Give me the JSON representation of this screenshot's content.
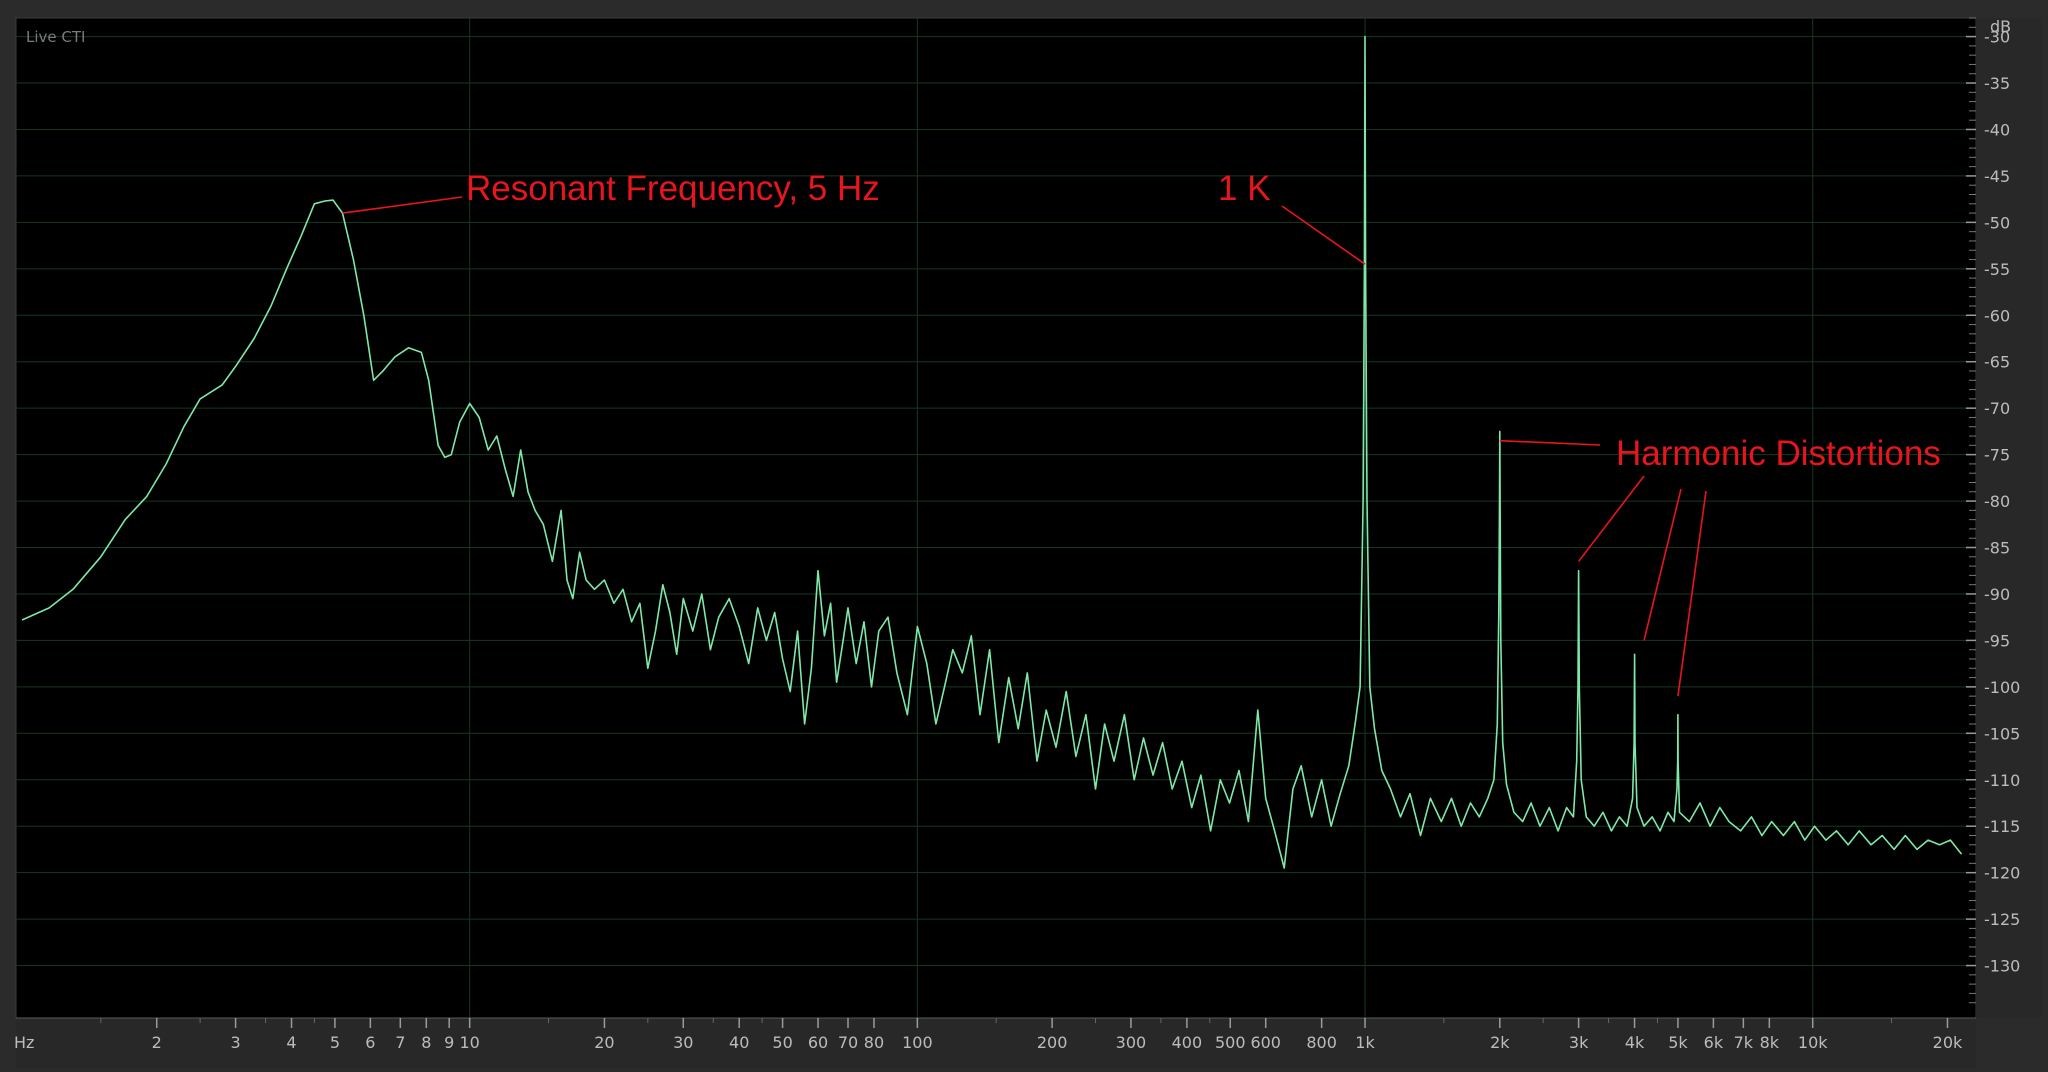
{
  "view": {
    "status_label": "Live CTI"
  },
  "chart_data": {
    "type": "line",
    "title": "",
    "xlabel": "Hz",
    "ylabel": "dB",
    "x_scale": "log",
    "xlim": [
      1,
      22000
    ],
    "ylim": [
      -135,
      -28
    ],
    "grid": true,
    "x_ticks": [
      {
        "value": 2,
        "label": "2"
      },
      {
        "value": 3,
        "label": "3"
      },
      {
        "value": 4,
        "label": "4"
      },
      {
        "value": 5,
        "label": "5"
      },
      {
        "value": 6,
        "label": "6"
      },
      {
        "value": 7,
        "label": "7"
      },
      {
        "value": 8,
        "label": "8"
      },
      {
        "value": 9,
        "label": "9"
      },
      {
        "value": 10,
        "label": "10"
      },
      {
        "value": 20,
        "label": "20"
      },
      {
        "value": 30,
        "label": "30"
      },
      {
        "value": 40,
        "label": "40"
      },
      {
        "value": 50,
        "label": "50"
      },
      {
        "value": 60,
        "label": "60"
      },
      {
        "value": 70,
        "label": "70"
      },
      {
        "value": 80,
        "label": "80"
      },
      {
        "value": 100,
        "label": "100"
      },
      {
        "value": 200,
        "label": "200"
      },
      {
        "value": 300,
        "label": "300"
      },
      {
        "value": 400,
        "label": "400"
      },
      {
        "value": 500,
        "label": "500"
      },
      {
        "value": 600,
        "label": "600"
      },
      {
        "value": 800,
        "label": "800"
      },
      {
        "value": 1000,
        "label": "1k"
      },
      {
        "value": 2000,
        "label": "2k"
      },
      {
        "value": 3000,
        "label": "3k"
      },
      {
        "value": 4000,
        "label": "4k"
      },
      {
        "value": 5000,
        "label": "5k"
      },
      {
        "value": 6000,
        "label": "6k"
      },
      {
        "value": 7000,
        "label": "7k"
      },
      {
        "value": 8000,
        "label": "8k"
      },
      {
        "value": 10000,
        "label": "10k"
      },
      {
        "value": 20000,
        "label": "20k"
      }
    ],
    "y_ticks": [
      {
        "value": -30,
        "label": "-30"
      },
      {
        "value": -35,
        "label": "-35"
      },
      {
        "value": -40,
        "label": "-40"
      },
      {
        "value": -45,
        "label": "-45"
      },
      {
        "value": -50,
        "label": "-50"
      },
      {
        "value": -55,
        "label": "-55"
      },
      {
        "value": -60,
        "label": "-60"
      },
      {
        "value": -65,
        "label": "-65"
      },
      {
        "value": -70,
        "label": "-70"
      },
      {
        "value": -75,
        "label": "-75"
      },
      {
        "value": -80,
        "label": "-80"
      },
      {
        "value": -85,
        "label": "-85"
      },
      {
        "value": -90,
        "label": "-90"
      },
      {
        "value": -95,
        "label": "-95"
      },
      {
        "value": -100,
        "label": "-100"
      },
      {
        "value": -105,
        "label": "-105"
      },
      {
        "value": -110,
        "label": "-110"
      },
      {
        "value": -115,
        "label": "-115"
      },
      {
        "value": -120,
        "label": "-120"
      },
      {
        "value": -125,
        "label": "-125"
      },
      {
        "value": -130,
        "label": "-130"
      }
    ],
    "series": [
      {
        "color": "#7ee8a8",
        "points": [
          [
            1.0,
            -92.8
          ],
          [
            1.15,
            -91.5
          ],
          [
            1.3,
            -89.5
          ],
          [
            1.5,
            -86
          ],
          [
            1.7,
            -82
          ],
          [
            1.9,
            -79.5
          ],
          [
            2.1,
            -76
          ],
          [
            2.3,
            -72
          ],
          [
            2.5,
            -69
          ],
          [
            2.8,
            -67.5
          ],
          [
            3.0,
            -65.5
          ],
          [
            3.3,
            -62.5
          ],
          [
            3.6,
            -59
          ],
          [
            3.9,
            -55
          ],
          [
            4.2,
            -51.5
          ],
          [
            4.5,
            -48
          ],
          [
            4.75,
            -47.7
          ],
          [
            4.95,
            -47.6
          ],
          [
            5.2,
            -49
          ],
          [
            5.5,
            -54
          ],
          [
            5.8,
            -60
          ],
          [
            6.1,
            -67
          ],
          [
            6.4,
            -66
          ],
          [
            6.8,
            -64.5
          ],
          [
            7.3,
            -63.5
          ],
          [
            7.8,
            -64
          ],
          [
            8.1,
            -67
          ],
          [
            8.5,
            -74
          ],
          [
            8.8,
            -75.3
          ],
          [
            9.1,
            -75
          ],
          [
            9.5,
            -71.5
          ],
          [
            10.0,
            -69.5
          ],
          [
            10.5,
            -71
          ],
          [
            11.0,
            -74.5
          ],
          [
            11.5,
            -73
          ],
          [
            12.0,
            -76.5
          ],
          [
            12.5,
            -79.5
          ],
          [
            13.0,
            -74.5
          ],
          [
            13.5,
            -79
          ],
          [
            14.0,
            -81
          ],
          [
            14.6,
            -82.5
          ],
          [
            15.3,
            -86.5
          ],
          [
            16.0,
            -81
          ],
          [
            16.5,
            -88.5
          ],
          [
            17.0,
            -90.5
          ],
          [
            17.6,
            -85.5
          ],
          [
            18.2,
            -88.5
          ],
          [
            19.0,
            -89.5
          ],
          [
            20.0,
            -88.5
          ],
          [
            21.0,
            -91
          ],
          [
            22.0,
            -89.5
          ],
          [
            23.0,
            -93
          ],
          [
            24.0,
            -91
          ],
          [
            25.0,
            -98
          ],
          [
            26.0,
            -94
          ],
          [
            27.0,
            -89
          ],
          [
            28.0,
            -92
          ],
          [
            29.0,
            -96.5
          ],
          [
            30.0,
            -90.5
          ],
          [
            31.5,
            -94
          ],
          [
            33.0,
            -90
          ],
          [
            34.5,
            -96
          ],
          [
            36.0,
            -92.5
          ],
          [
            38.0,
            -90.5
          ],
          [
            40.0,
            -93.5
          ],
          [
            42.0,
            -97.5
          ],
          [
            44.0,
            -91.5
          ],
          [
            46.0,
            -95
          ],
          [
            48.0,
            -92
          ],
          [
            50.0,
            -97
          ],
          [
            52.0,
            -100.5
          ],
          [
            54.0,
            -94
          ],
          [
            56.0,
            -104
          ],
          [
            58.0,
            -98
          ],
          [
            60.0,
            -87.5
          ],
          [
            62.0,
            -94.5
          ],
          [
            64.0,
            -91
          ],
          [
            66.0,
            -99.5
          ],
          [
            68.0,
            -95.5
          ],
          [
            70.0,
            -91.5
          ],
          [
            73.0,
            -97.5
          ],
          [
            76.0,
            -93
          ],
          [
            79.0,
            -100
          ],
          [
            82.0,
            -94
          ],
          [
            86.0,
            -92.5
          ],
          [
            90.0,
            -98.5
          ],
          [
            95.0,
            -103
          ],
          [
            100.0,
            -93.5
          ],
          [
            105.0,
            -97.5
          ],
          [
            110.0,
            -104
          ],
          [
            115.0,
            -100
          ],
          [
            120.0,
            -96
          ],
          [
            126.0,
            -98.5
          ],
          [
            132.0,
            -94.5
          ],
          [
            138.0,
            -103
          ],
          [
            145.0,
            -96
          ],
          [
            152.0,
            -106
          ],
          [
            160.0,
            -99
          ],
          [
            168.0,
            -104.5
          ],
          [
            176.0,
            -98.5
          ],
          [
            185.0,
            -108
          ],
          [
            194.0,
            -102.5
          ],
          [
            204.0,
            -106.5
          ],
          [
            215.0,
            -100.5
          ],
          [
            226.0,
            -107.5
          ],
          [
            238.0,
            -103
          ],
          [
            250.0,
            -111
          ],
          [
            262.0,
            -104
          ],
          [
            275.0,
            -108
          ],
          [
            290.0,
            -103
          ],
          [
            305.0,
            -110
          ],
          [
            320.0,
            -105.5
          ],
          [
            336.0,
            -109.5
          ],
          [
            353.0,
            -106
          ],
          [
            371.0,
            -111
          ],
          [
            390.0,
            -108
          ],
          [
            410.0,
            -113
          ],
          [
            430.0,
            -109.5
          ],
          [
            452.0,
            -115.5
          ],
          [
            475.0,
            -110
          ],
          [
            498.0,
            -112.5
          ],
          [
            523.0,
            -109
          ],
          [
            549.0,
            -114.5
          ],
          [
            576.0,
            -102.5
          ],
          [
            600.0,
            -112
          ],
          [
            628.0,
            -115.5
          ],
          [
            660.0,
            -119.5
          ],
          [
            690.0,
            -111
          ],
          [
            720.0,
            -108.5
          ],
          [
            760.0,
            -114
          ],
          [
            800.0,
            -110
          ],
          [
            840.0,
            -115
          ],
          [
            880.0,
            -111.5
          ],
          [
            920.0,
            -108.5
          ],
          [
            950.0,
            -104
          ],
          [
            975.0,
            -100
          ],
          [
            990.0,
            -80
          ],
          [
            997.0,
            -55
          ],
          [
            1000.0,
            -30
          ],
          [
            1003.0,
            -55
          ],
          [
            1010.0,
            -80
          ],
          [
            1025.0,
            -100
          ],
          [
            1050.0,
            -104.5
          ],
          [
            1090.0,
            -109
          ],
          [
            1140.0,
            -111
          ],
          [
            1200.0,
            -114
          ],
          [
            1260.0,
            -111.5
          ],
          [
            1330.0,
            -116
          ],
          [
            1400.0,
            -112
          ],
          [
            1480.0,
            -114.5
          ],
          [
            1560.0,
            -112
          ],
          [
            1640.0,
            -115
          ],
          [
            1720.0,
            -112.5
          ],
          [
            1800.0,
            -114
          ],
          [
            1880.0,
            -112
          ],
          [
            1940.0,
            -110
          ],
          [
            1975.0,
            -104
          ],
          [
            1990.0,
            -92
          ],
          [
            1997.0,
            -80
          ],
          [
            2000.0,
            -72.5
          ],
          [
            2003.0,
            -80
          ],
          [
            2010.0,
            -95
          ],
          [
            2030.0,
            -106
          ],
          [
            2070.0,
            -110.5
          ],
          [
            2150.0,
            -113.5
          ],
          [
            2250.0,
            -114.5
          ],
          [
            2350.0,
            -112.5
          ],
          [
            2460.0,
            -115
          ],
          [
            2580.0,
            -113
          ],
          [
            2700.0,
            -115.5
          ],
          [
            2820.0,
            -113
          ],
          [
            2920.0,
            -114
          ],
          [
            2970.0,
            -108
          ],
          [
            2990.0,
            -100
          ],
          [
            3000.0,
            -87.5
          ],
          [
            3010.0,
            -100
          ],
          [
            3040.0,
            -110
          ],
          [
            3120.0,
            -114
          ],
          [
            3250.0,
            -115
          ],
          [
            3400.0,
            -113.5
          ],
          [
            3550.0,
            -115.5
          ],
          [
            3700.0,
            -114
          ],
          [
            3850.0,
            -115
          ],
          [
            3960.0,
            -112
          ],
          [
            3990.0,
            -106
          ],
          [
            4000.0,
            -96.5
          ],
          [
            4010.0,
            -106
          ],
          [
            4050.0,
            -113
          ],
          [
            4200.0,
            -115
          ],
          [
            4380.0,
            -114
          ],
          [
            4560.0,
            -115.5
          ],
          [
            4750.0,
            -113.5
          ],
          [
            4900.0,
            -114.5
          ],
          [
            4975.0,
            -111
          ],
          [
            4995.0,
            -108
          ],
          [
            5000.0,
            -103
          ],
          [
            5005.0,
            -108
          ],
          [
            5040.0,
            -113.5
          ],
          [
            5300.0,
            -114.5
          ],
          [
            5600.0,
            -112.5
          ],
          [
            5900.0,
            -115
          ],
          [
            6200.0,
            -113
          ],
          [
            6500.0,
            -114.5
          ],
          [
            6900.0,
            -115.5
          ],
          [
            7300.0,
            -114
          ],
          [
            7700.0,
            -116
          ],
          [
            8100.0,
            -114.5
          ],
          [
            8600.0,
            -116
          ],
          [
            9100.0,
            -114.5
          ],
          [
            9600.0,
            -116.5
          ],
          [
            10100.0,
            -115
          ],
          [
            10700.0,
            -116.5
          ],
          [
            11300.0,
            -115.5
          ],
          [
            12000.0,
            -117
          ],
          [
            12700.0,
            -115.5
          ],
          [
            13500.0,
            -117
          ],
          [
            14300.0,
            -116
          ],
          [
            15200.0,
            -117.5
          ],
          [
            16100.0,
            -116
          ],
          [
            17100.0,
            -117.5
          ],
          [
            18100.0,
            -116.5
          ],
          [
            19200.0,
            -117
          ],
          [
            20300.0,
            -116.5
          ],
          [
            21500.0,
            -118
          ]
        ]
      }
    ],
    "annotations": [
      {
        "text": "Resonant Frequency, 5 Hz",
        "target": [
          5.2,
          -49.0
        ]
      },
      {
        "text": "1 K",
        "target": [
          1000,
          -54.5
        ]
      },
      {
        "text": "Harmonic Distortions",
        "targets": [
          [
            2000,
            -73.5
          ],
          [
            3000,
            -86.5
          ],
          [
            4200,
            -95.0
          ],
          [
            5000,
            -101.0
          ]
        ]
      }
    ]
  }
}
